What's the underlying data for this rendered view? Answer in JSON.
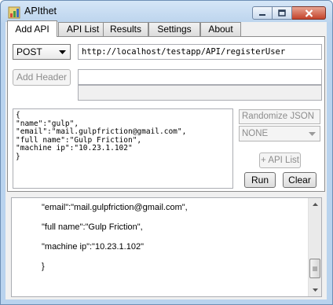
{
  "window": {
    "title": "APIthet",
    "icon": "app-icon"
  },
  "tabs": [
    {
      "label": "Add API",
      "active": true
    },
    {
      "label": "API List",
      "active": false
    },
    {
      "label": "Results",
      "active": false
    },
    {
      "label": "Settings",
      "active": false
    },
    {
      "label": "About",
      "active": false
    }
  ],
  "request": {
    "method": "POST",
    "url": "http://localhost/testapp/API/registerUser",
    "add_header_label": "Add Header",
    "header_name": "",
    "header_value": ""
  },
  "json_body": [
    "{",
    "\"name\":\"gulp\",",
    "\"email\":\"mail.gulpfriction@gmail.com\",",
    "\"full name\":\"Gulp Friction\",",
    "\"machine ip\":\"10.23.1.102\"",
    "}"
  ],
  "side": {
    "randomize_placeholder": "Randomize JSON",
    "randomize_select": "NONE",
    "api_list_button": "+ API List",
    "run_button": "Run",
    "clear_button": "Clear"
  },
  "output_lines": [
    "\"email\":\"mail.gulpfriction@gmail.com\",",
    "\"full name\":\"Gulp Friction\",",
    "\"machine ip\":\"10.23.1.102\"",
    "}"
  ],
  "colors": {
    "frame": "#b9d3ee",
    "close_button": "#c4432b",
    "client": "#f0f0f0"
  }
}
